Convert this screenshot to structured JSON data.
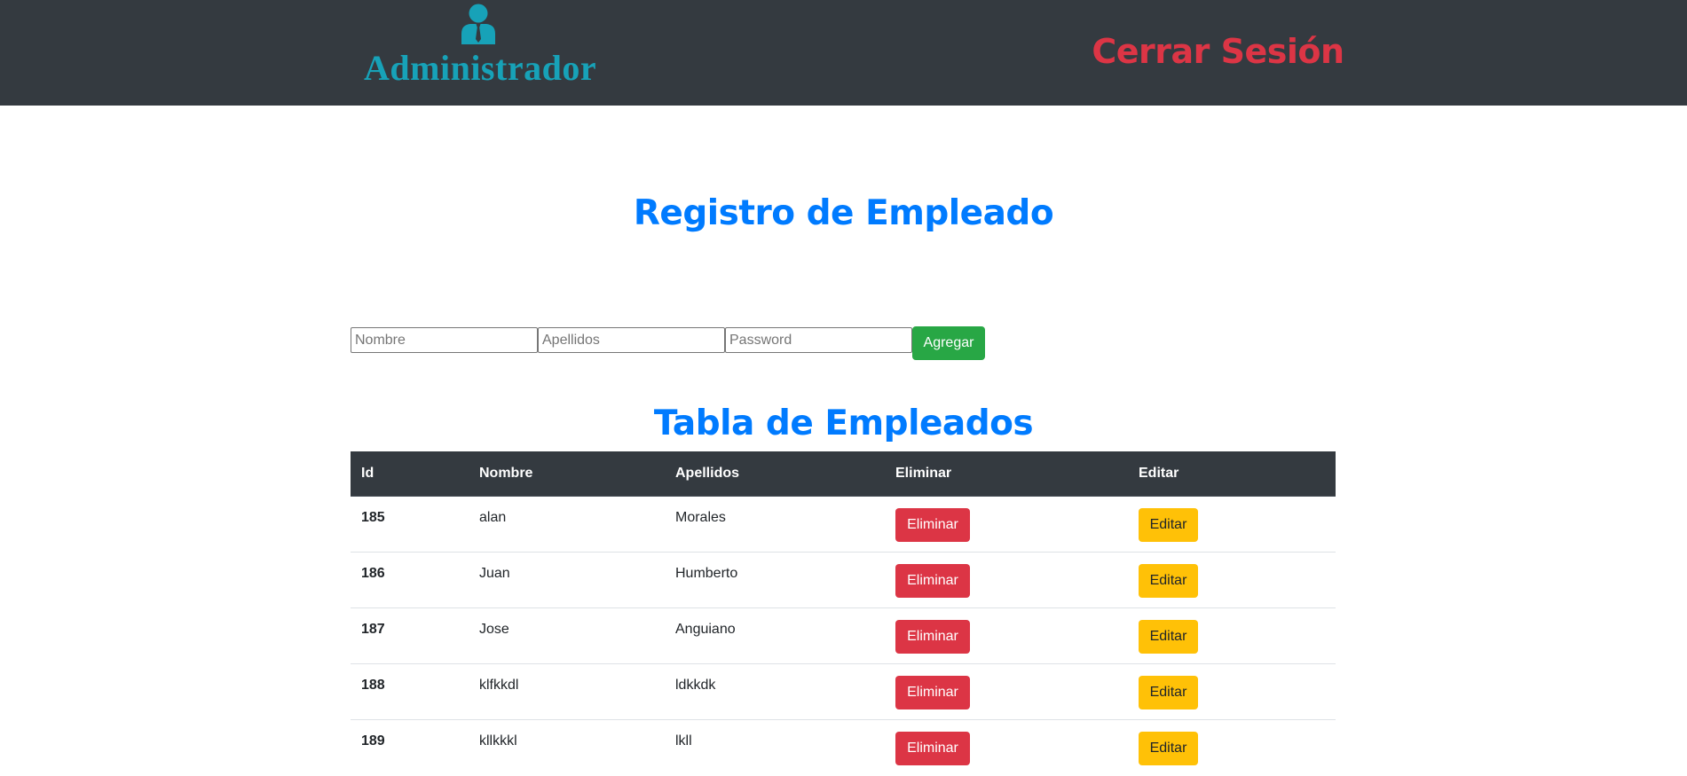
{
  "header": {
    "admin_icon": "user-tie-icon",
    "admin_title": "Administrador",
    "logout_label": "Cerrar Sesión",
    "colors": {
      "bar": "#343a40",
      "admin": "#17a2b8",
      "logout": "#dc3545"
    }
  },
  "form": {
    "title": "Registro de Empleado",
    "nombre_placeholder": "Nombre",
    "apellidos_placeholder": "Apellidos",
    "password_placeholder": "Password",
    "submit_label": "Agregar"
  },
  "table": {
    "title": "Tabla de Empleados",
    "columns": [
      "Id",
      "Nombre",
      "Apellidos",
      "Eliminar",
      "Editar"
    ],
    "rows": [
      {
        "id": "185",
        "nombre": "alan",
        "apellidos": "Morales",
        "delete_label": "Eliminar",
        "edit_label": "Editar"
      },
      {
        "id": "186",
        "nombre": "Juan",
        "apellidos": "Humberto",
        "delete_label": "Eliminar",
        "edit_label": "Editar"
      },
      {
        "id": "187",
        "nombre": "Jose",
        "apellidos": "Anguiano",
        "delete_label": "Eliminar",
        "edit_label": "Editar"
      },
      {
        "id": "188",
        "nombre": "klfkkdl",
        "apellidos": "ldkkdk",
        "delete_label": "Eliminar",
        "edit_label": "Editar"
      },
      {
        "id": "189",
        "nombre": "kllkkkl",
        "apellidos": "lkll",
        "delete_label": "Eliminar",
        "edit_label": "Editar"
      }
    ]
  },
  "colors": {
    "heading": "#007bff",
    "add_button": "#28a745",
    "delete_button": "#dc3545",
    "edit_button": "#ffc107"
  }
}
